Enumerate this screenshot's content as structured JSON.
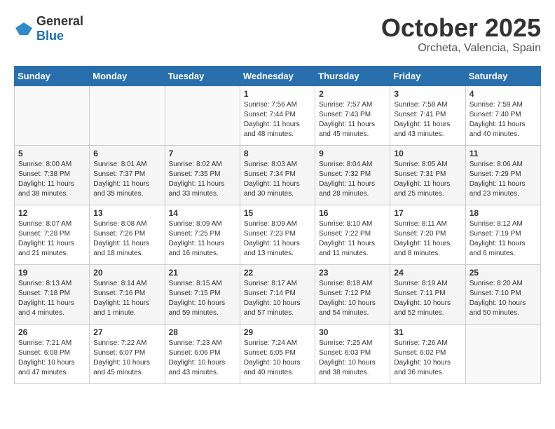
{
  "header": {
    "logo_general": "General",
    "logo_blue": "Blue",
    "month": "October 2025",
    "location": "Orcheta, Valencia, Spain"
  },
  "days_of_week": [
    "Sunday",
    "Monday",
    "Tuesday",
    "Wednesday",
    "Thursday",
    "Friday",
    "Saturday"
  ],
  "weeks": [
    [
      {
        "day": "",
        "info": ""
      },
      {
        "day": "",
        "info": ""
      },
      {
        "day": "",
        "info": ""
      },
      {
        "day": "1",
        "info": "Sunrise: 7:56 AM\nSunset: 7:44 PM\nDaylight: 11 hours\nand 48 minutes."
      },
      {
        "day": "2",
        "info": "Sunrise: 7:57 AM\nSunset: 7:43 PM\nDaylight: 11 hours\nand 45 minutes."
      },
      {
        "day": "3",
        "info": "Sunrise: 7:58 AM\nSunset: 7:41 PM\nDaylight: 11 hours\nand 43 minutes."
      },
      {
        "day": "4",
        "info": "Sunrise: 7:59 AM\nSunset: 7:40 PM\nDaylight: 11 hours\nand 40 minutes."
      }
    ],
    [
      {
        "day": "5",
        "info": "Sunrise: 8:00 AM\nSunset: 7:38 PM\nDaylight: 11 hours\nand 38 minutes."
      },
      {
        "day": "6",
        "info": "Sunrise: 8:01 AM\nSunset: 7:37 PM\nDaylight: 11 hours\nand 35 minutes."
      },
      {
        "day": "7",
        "info": "Sunrise: 8:02 AM\nSunset: 7:35 PM\nDaylight: 11 hours\nand 33 minutes."
      },
      {
        "day": "8",
        "info": "Sunrise: 8:03 AM\nSunset: 7:34 PM\nDaylight: 11 hours\nand 30 minutes."
      },
      {
        "day": "9",
        "info": "Sunrise: 8:04 AM\nSunset: 7:32 PM\nDaylight: 11 hours\nand 28 minutes."
      },
      {
        "day": "10",
        "info": "Sunrise: 8:05 AM\nSunset: 7:31 PM\nDaylight: 11 hours\nand 25 minutes."
      },
      {
        "day": "11",
        "info": "Sunrise: 8:06 AM\nSunset: 7:29 PM\nDaylight: 11 hours\nand 23 minutes."
      }
    ],
    [
      {
        "day": "12",
        "info": "Sunrise: 8:07 AM\nSunset: 7:28 PM\nDaylight: 11 hours\nand 21 minutes."
      },
      {
        "day": "13",
        "info": "Sunrise: 8:08 AM\nSunset: 7:26 PM\nDaylight: 11 hours\nand 18 minutes."
      },
      {
        "day": "14",
        "info": "Sunrise: 8:09 AM\nSunset: 7:25 PM\nDaylight: 11 hours\nand 16 minutes."
      },
      {
        "day": "15",
        "info": "Sunrise: 8:09 AM\nSunset: 7:23 PM\nDaylight: 11 hours\nand 13 minutes."
      },
      {
        "day": "16",
        "info": "Sunrise: 8:10 AM\nSunset: 7:22 PM\nDaylight: 11 hours\nand 11 minutes."
      },
      {
        "day": "17",
        "info": "Sunrise: 8:11 AM\nSunset: 7:20 PM\nDaylight: 11 hours\nand 8 minutes."
      },
      {
        "day": "18",
        "info": "Sunrise: 8:12 AM\nSunset: 7:19 PM\nDaylight: 11 hours\nand 6 minutes."
      }
    ],
    [
      {
        "day": "19",
        "info": "Sunrise: 8:13 AM\nSunset: 7:18 PM\nDaylight: 11 hours\nand 4 minutes."
      },
      {
        "day": "20",
        "info": "Sunrise: 8:14 AM\nSunset: 7:16 PM\nDaylight: 11 hours\nand 1 minute."
      },
      {
        "day": "21",
        "info": "Sunrise: 8:15 AM\nSunset: 7:15 PM\nDaylight: 10 hours\nand 59 minutes."
      },
      {
        "day": "22",
        "info": "Sunrise: 8:17 AM\nSunset: 7:14 PM\nDaylight: 10 hours\nand 57 minutes."
      },
      {
        "day": "23",
        "info": "Sunrise: 8:18 AM\nSunset: 7:12 PM\nDaylight: 10 hours\nand 54 minutes."
      },
      {
        "day": "24",
        "info": "Sunrise: 8:19 AM\nSunset: 7:11 PM\nDaylight: 10 hours\nand 52 minutes."
      },
      {
        "day": "25",
        "info": "Sunrise: 8:20 AM\nSunset: 7:10 PM\nDaylight: 10 hours\nand 50 minutes."
      }
    ],
    [
      {
        "day": "26",
        "info": "Sunrise: 7:21 AM\nSunset: 6:08 PM\nDaylight: 10 hours\nand 47 minutes."
      },
      {
        "day": "27",
        "info": "Sunrise: 7:22 AM\nSunset: 6:07 PM\nDaylight: 10 hours\nand 45 minutes."
      },
      {
        "day": "28",
        "info": "Sunrise: 7:23 AM\nSunset: 6:06 PM\nDaylight: 10 hours\nand 43 minutes."
      },
      {
        "day": "29",
        "info": "Sunrise: 7:24 AM\nSunset: 6:05 PM\nDaylight: 10 hours\nand 40 minutes."
      },
      {
        "day": "30",
        "info": "Sunrise: 7:25 AM\nSunset: 6:03 PM\nDaylight: 10 hours\nand 38 minutes."
      },
      {
        "day": "31",
        "info": "Sunrise: 7:26 AM\nSunset: 6:02 PM\nDaylight: 10 hours\nand 36 minutes."
      },
      {
        "day": "",
        "info": ""
      }
    ]
  ]
}
